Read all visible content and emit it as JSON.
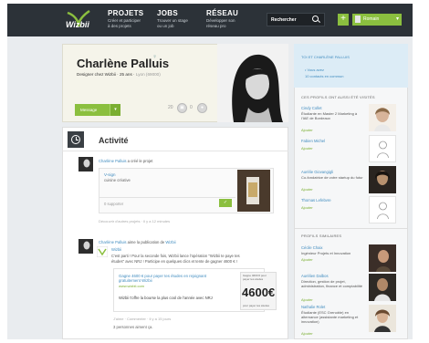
{
  "topbar": {
    "logo_text": "Wizbii",
    "nav": [
      {
        "title": "PROJETS",
        "sub1": "Créer et participer",
        "sub2": "à des projets"
      },
      {
        "title": "JOBS",
        "sub1": "Trouver un stage",
        "sub2": "ou un job"
      },
      {
        "title": "RÉSEAU",
        "sub1": "Développer son",
        "sub2": "réseau pro"
      }
    ],
    "search_placeholder": "Rechercher",
    "plus_label": "+",
    "user_name": "Romain"
  },
  "profile": {
    "name": "Charlène Palluis",
    "bio_main": "Designer chez Wizbii · 25 ans · ",
    "bio_location": "Lyon (69000)",
    "message_button": "Message",
    "stats": [
      {
        "value": "20"
      },
      {
        "value": "0"
      }
    ]
  },
  "activity": {
    "title": "Activité",
    "item1": {
      "user": "Charlène Palluis",
      "action": " a créé le projet",
      "project_title": "V-sign",
      "project_sub": "cuisine créative",
      "supporters": "0 supporter",
      "meta": "Découvrir d'autres projets · Il y a 12 minutes"
    },
    "item2": {
      "user": "Charlène Palluis",
      "action": " aime la publication de ",
      "target": "Wizbii",
      "org": "Wizbii",
      "text1": "C'est parti ! Pour la seconde fois, Wizbii lance l'opération \"Wizbii te paye tes",
      "text2": "études\" avec NRJ ! Participe en quelques clics et tente de gagner 4600 € !",
      "link_title": "Gagne 4600 € pour payer tes études en rejoignant gratuitement Wizbii",
      "link_url": "www.wizbii.com",
      "link_desc": "Wizbii t'offre la bourse la plus cool de l'année avec NRJ",
      "ad_top": "Gagne 4600 € pour payer tes études",
      "ad_price": "4600€",
      "ad_bottom": "pour payer tes études",
      "meta": "J'aime · Commenter · Il y a 15 jours",
      "likes": "3 personnes aiment ça."
    }
  },
  "sidebar": {
    "top_heading": "TOI ET CHARLÈNE PALLUIS",
    "top_item1": "• Vous avez",
    "top_item2": "10 contacts en commun",
    "heading_visited": "CES PROFILS ONT AUSSI ÉTÉ VISITÉS",
    "visited": [
      {
        "name": "Cindy Collet",
        "desc": "Étudiante en Master 2 Marketing à l'IAE de Bordeaux",
        "add": "Ajouter"
      },
      {
        "name": "Fabien Michel",
        "desc": "",
        "add": "Ajouter"
      },
      {
        "name": "Aurélie Giovangigli",
        "desc": "Co-fondatrice de votre startup du futur",
        "add": "Ajouter"
      },
      {
        "name": "Thomas Lefebvre",
        "desc": "",
        "add": "Ajouter"
      }
    ],
    "heading_similar": "PROFILS SIMILAIRES",
    "similar": [
      {
        "name": "Cécile Chaix",
        "desc": "Ingénieur Projets et Innovation",
        "add": "Ajouter"
      },
      {
        "name": "Aurélien Dalbos",
        "desc": "Direction, gestion de projet, administration, finance et comptabilité",
        "add": "Ajouter"
      },
      {
        "name": "Nathalie Rolet",
        "desc": "Étudiante (ESC Grenoble) en alternance (assistante marketing et innovation)",
        "add": "Ajouter"
      }
    ]
  }
}
